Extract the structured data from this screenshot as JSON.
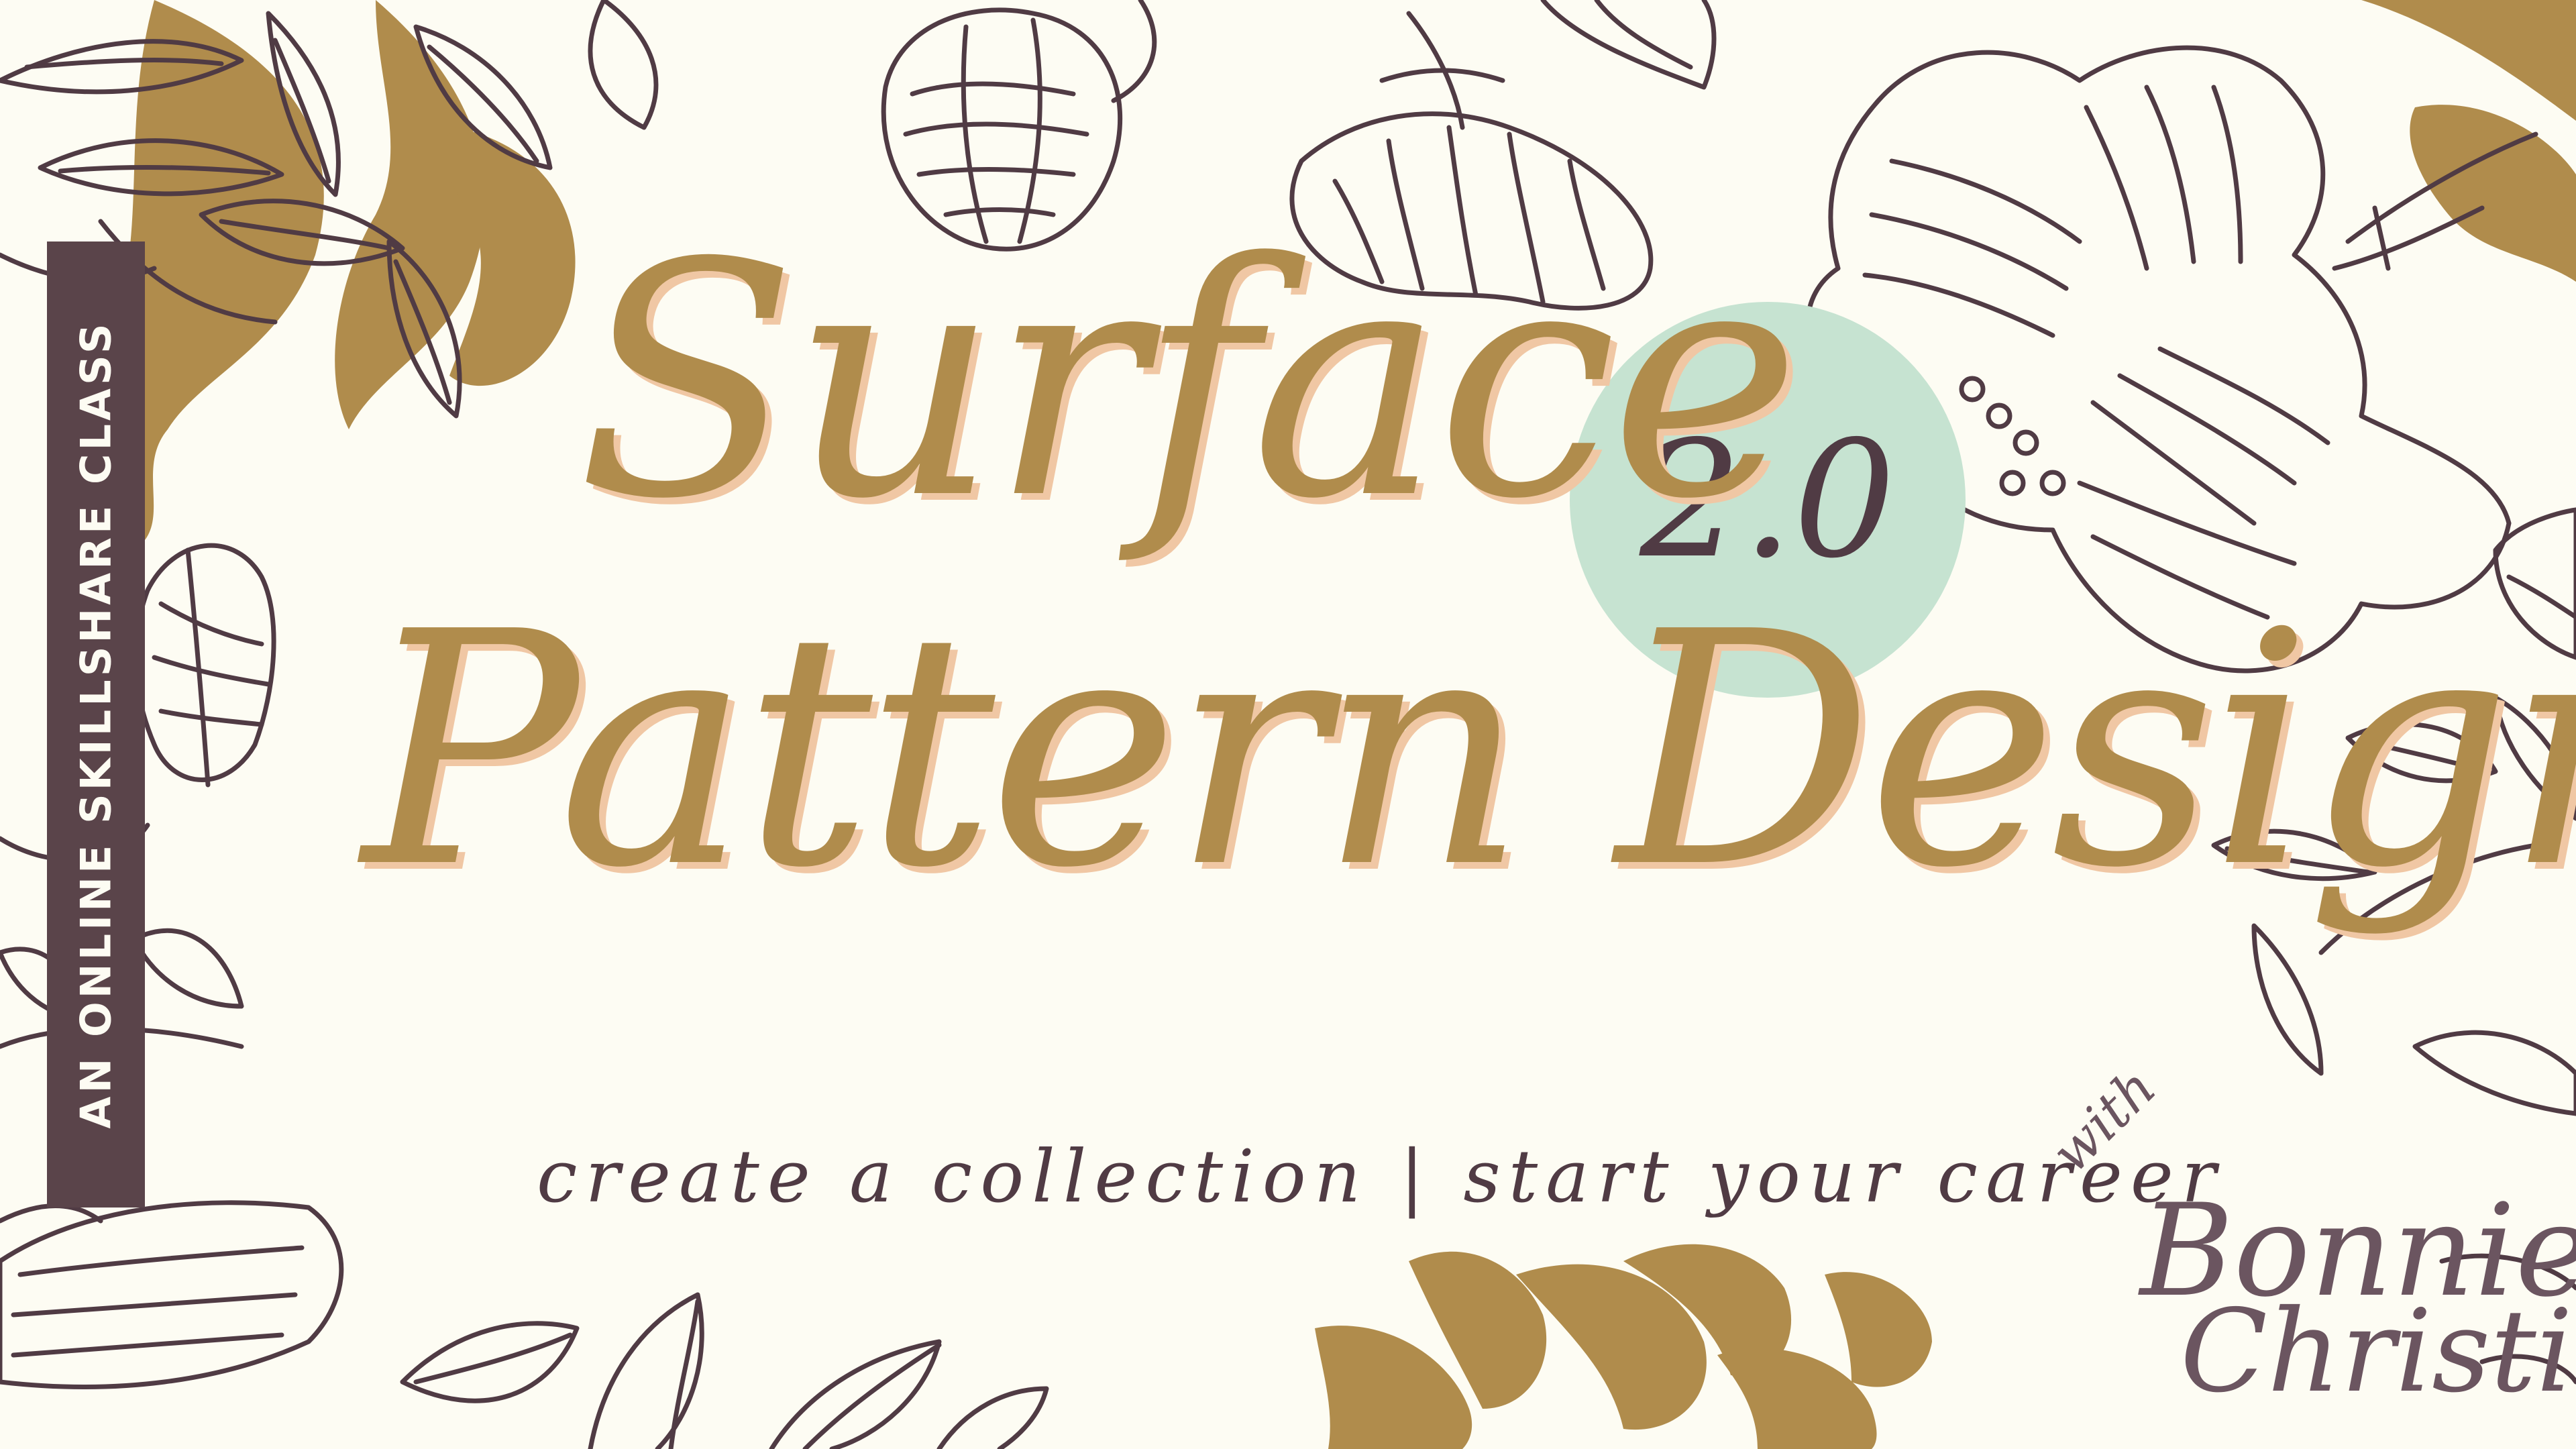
{
  "banner": {
    "label": "AN ONLINE SKILLSHARE CLASS"
  },
  "title": {
    "line1": "Surface",
    "line2": "Pattern Design",
    "version": "2.0"
  },
  "tagline": "create a collection  |  start your career",
  "author": {
    "prefix": "with",
    "first_name": "Bonnie",
    "last_name": "Christine"
  },
  "colors": {
    "background": "#fdfcf3",
    "gold": "#b08c4c",
    "shadow_peach": "#f0c7a4",
    "plum": "#503b44",
    "mint": "#c6e3d1"
  },
  "icons": [
    "floral-line-art",
    "gold-leaf-silhouette"
  ]
}
